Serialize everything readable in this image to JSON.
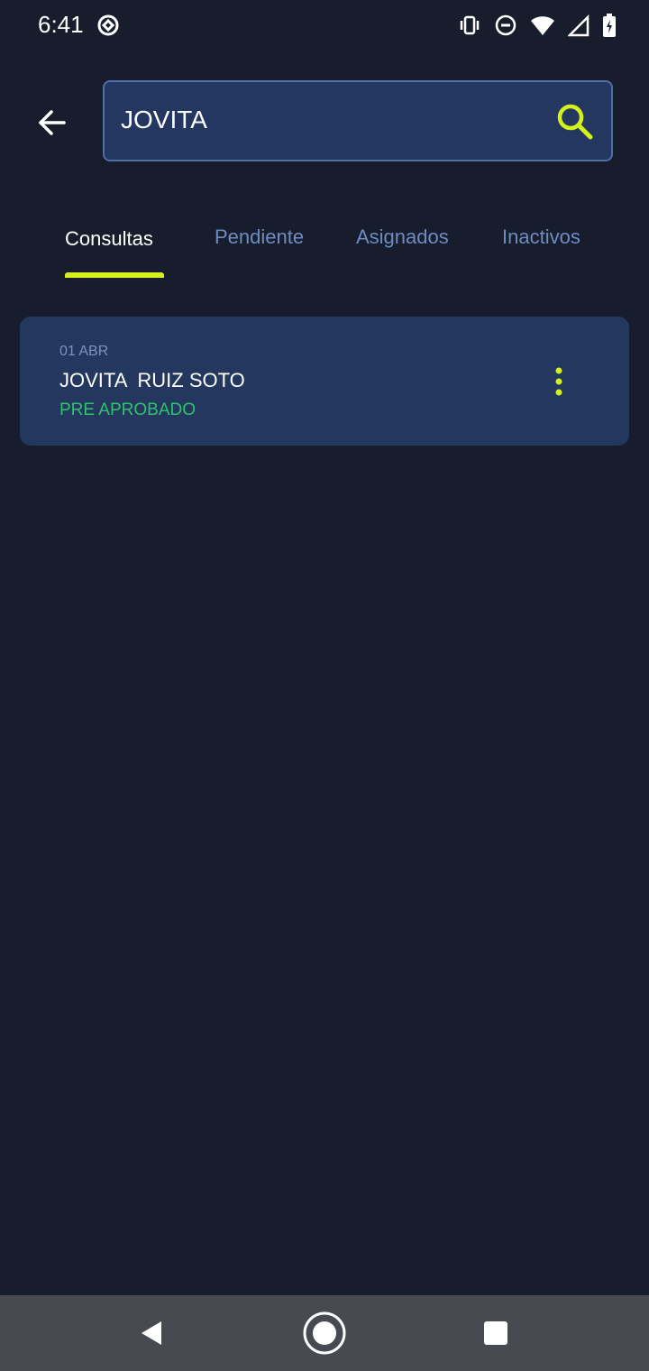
{
  "status_bar": {
    "time": "6:41"
  },
  "search": {
    "value": "JOVITA"
  },
  "tabs": [
    {
      "label": "Consultas"
    },
    {
      "label": "Pendiente"
    },
    {
      "label": "Asignados"
    },
    {
      "label": "Inactivos"
    }
  ],
  "results": [
    {
      "date": "01 ABR",
      "name": "JOVITA  RUIZ SOTO",
      "status": "PRE APROBADO"
    }
  ],
  "colors": {
    "background": "#171d2c",
    "card": "#24375f",
    "accent": "#d6f01e",
    "status_ok": "#2fc36b",
    "tab_inactive": "#6e8cc0"
  }
}
